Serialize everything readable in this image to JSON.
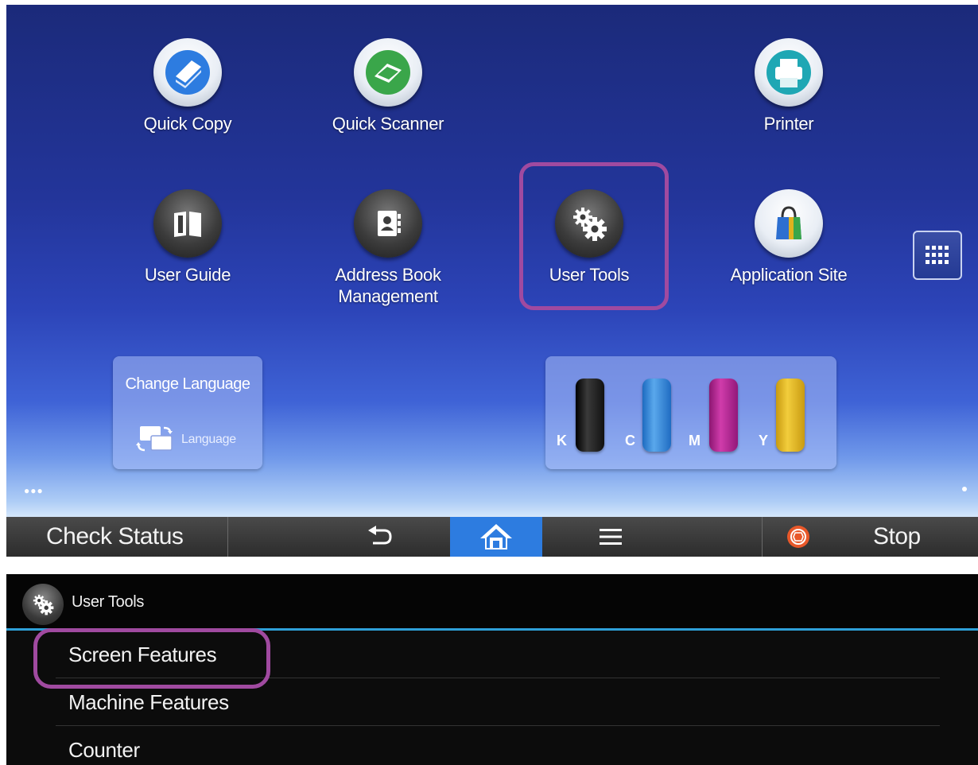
{
  "home": {
    "apps": [
      {
        "label": "Quick Copy",
        "icon": "quick-copy-icon"
      },
      {
        "label": "Quick Scanner",
        "icon": "quick-scanner-icon"
      },
      {
        "label": "Printer",
        "icon": "printer-icon"
      },
      {
        "label": "User Guide",
        "icon": "user-guide-icon"
      },
      {
        "label": "Address Book\nManagement",
        "icon": "address-book-icon"
      },
      {
        "label": "User Tools",
        "icon": "user-tools-icon"
      },
      {
        "label": "Application Site",
        "icon": "application-site-icon"
      }
    ],
    "language_widget": {
      "title": "Change Language",
      "sub": "Language"
    },
    "toner": [
      {
        "label": "K",
        "color": "#1a1a1a"
      },
      {
        "label": "C",
        "color": "#2a84d8"
      },
      {
        "label": "M",
        "color": "#b0208f"
      },
      {
        "label": "Y",
        "color": "#e0b21e"
      }
    ],
    "colors": {
      "highlight": "#a04aa0",
      "home_active": "#2d7ce0"
    }
  },
  "statusbar": {
    "check_status": "Check Status",
    "stop": "Stop"
  },
  "user_tools": {
    "title": "User Tools",
    "items": [
      "Screen Features",
      "Machine Features",
      "Counter"
    ],
    "accent": "#2ea0d8"
  }
}
